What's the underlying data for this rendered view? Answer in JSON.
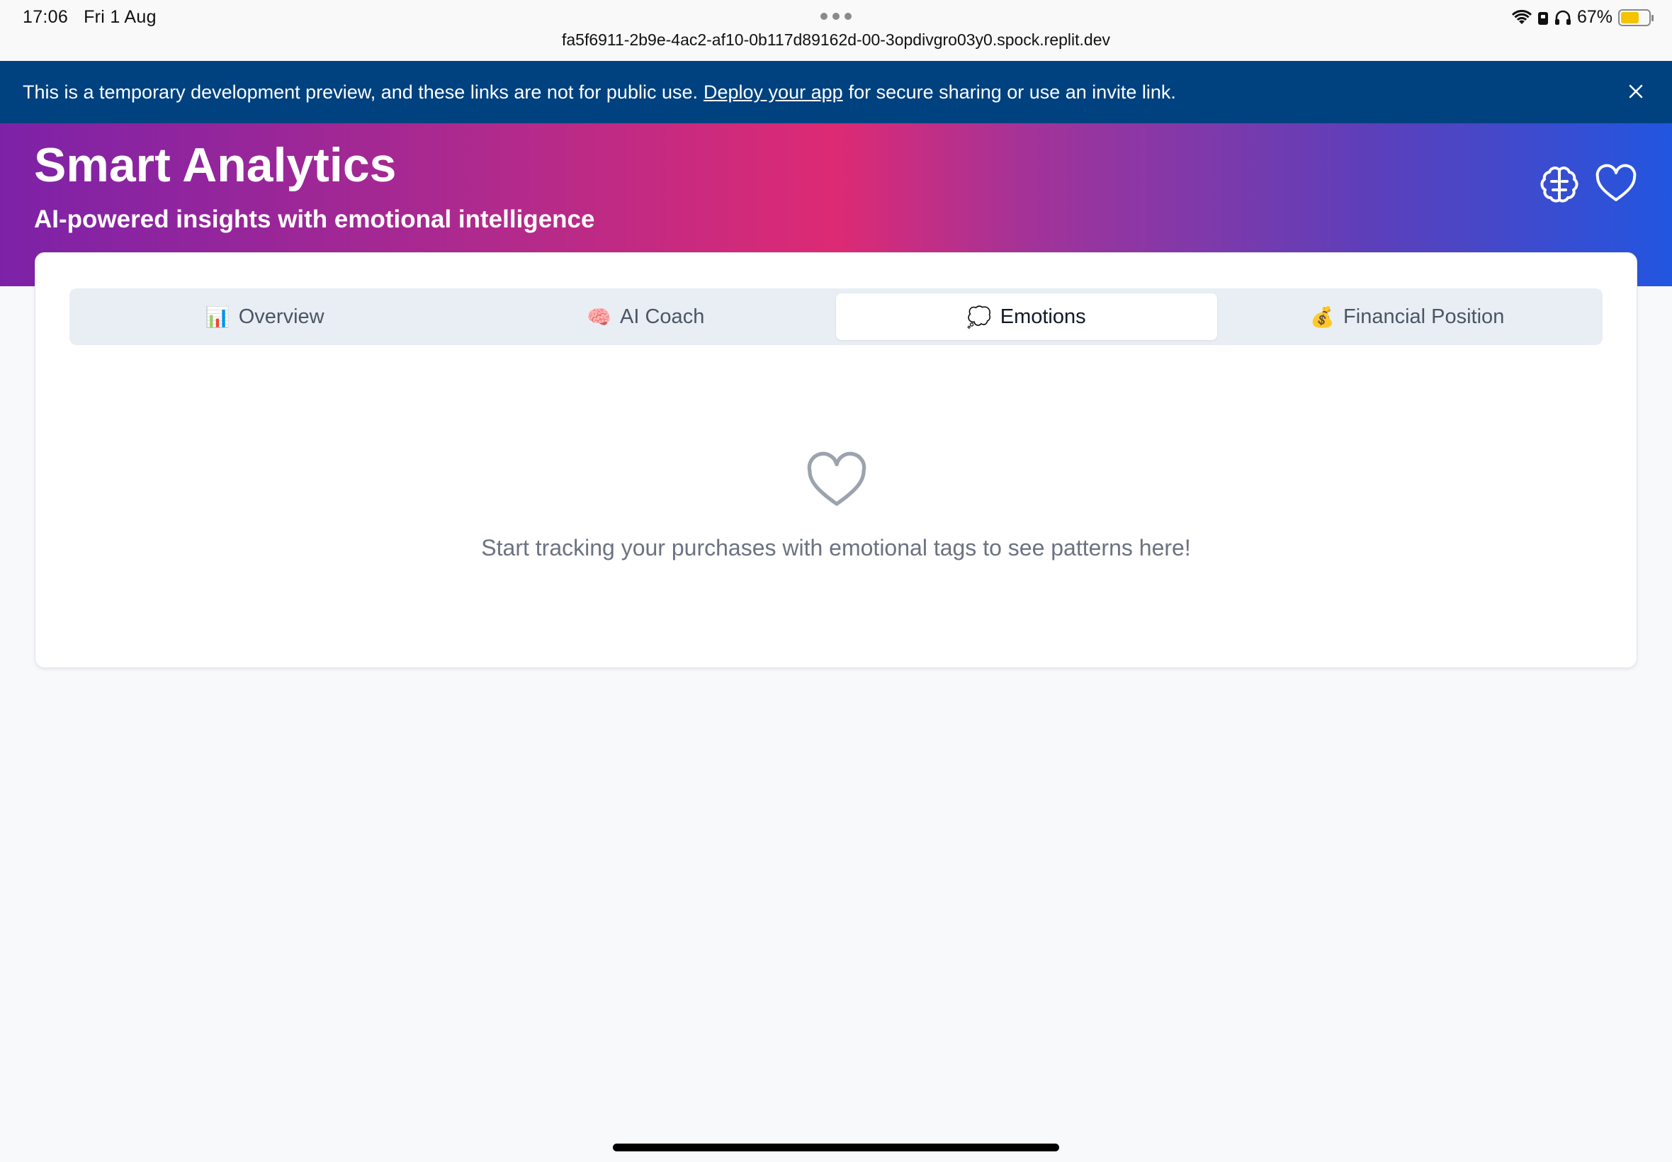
{
  "status_bar": {
    "time": "17:06",
    "date": "Fri 1 Aug",
    "url": "fa5f6911-2b9e-4ac2-af10-0b117d89162d-00-3opdivgro03y0.spock.replit.dev",
    "battery": "67%",
    "icons": [
      "wifi-icon",
      "lock-icon",
      "headphones-icon",
      "battery-icon"
    ]
  },
  "banner": {
    "text_before": "This is a temporary development preview, and these links are not for public use.",
    "link": "Deploy your app",
    "text_after": "for secure sharing or use an invite link."
  },
  "hero": {
    "title": "Smart Analytics",
    "subtitle": "AI-powered insights with emotional intelligence",
    "icons": [
      "brain-icon",
      "heart-icon"
    ]
  },
  "tabs": [
    {
      "emoji": "📊",
      "label": "Overview",
      "active": false
    },
    {
      "emoji": "🧠",
      "label": "AI Coach",
      "active": false
    },
    {
      "emoji": "💭",
      "label": "Emotions",
      "active": true
    },
    {
      "emoji": "💰",
      "label": "Financial Position",
      "active": false
    }
  ],
  "empty_state": {
    "message": "Start tracking your purchases with emotional tags to see patterns here!"
  },
  "colors": {
    "banner": "#00417f",
    "gradient_start": "#7d22a8",
    "gradient_mid": "#dd2a74",
    "gradient_end": "#2256e0"
  }
}
